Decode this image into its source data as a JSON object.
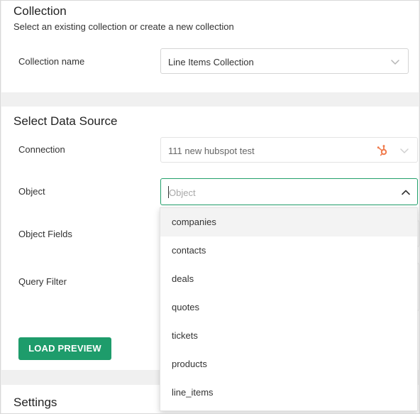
{
  "collection": {
    "title": "Collection",
    "subtitle": "Select an existing collection or create a new collection",
    "name_label": "Collection name",
    "name_value": "Line Items Collection"
  },
  "data_source": {
    "title": "Select Data Source",
    "connection_label": "Connection",
    "connection_value": "111 new hubspot test",
    "connection_icon": "hubspot-icon",
    "object_label": "Object",
    "object_placeholder": "Object",
    "object_fields_label": "Object Fields",
    "query_filter_label": "Query Filter",
    "load_preview_label": "LOAD PREVIEW"
  },
  "object_dropdown": {
    "options": [
      "companies",
      "contacts",
      "deals",
      "quotes",
      "tickets",
      "products",
      "line_items"
    ]
  },
  "settings": {
    "title": "Settings"
  },
  "colors": {
    "accent": "#1e9c6b",
    "focus_border": "#22a06b",
    "hubspot": "#f07b4d"
  }
}
